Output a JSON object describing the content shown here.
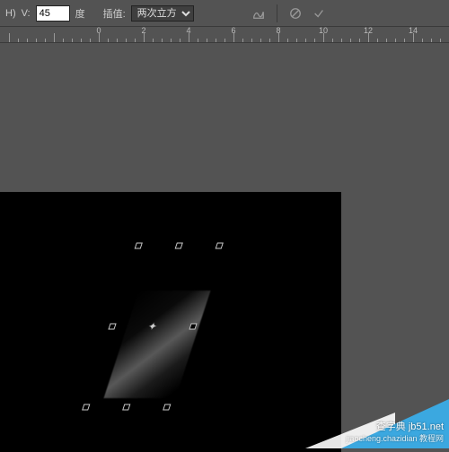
{
  "toolbar": {
    "v_label": "V:",
    "v_value": "45",
    "v_unit": "度",
    "interp_label": "插值:",
    "interp_value": "两次立方"
  },
  "ruler": {
    "majors": [
      {
        "pos": 10,
        "label": ""
      },
      {
        "pos": 60,
        "label": ""
      },
      {
        "pos": 110,
        "label": "0"
      },
      {
        "pos": 160,
        "label": "2"
      },
      {
        "pos": 210,
        "label": "4"
      },
      {
        "pos": 260,
        "label": "6"
      },
      {
        "pos": 310,
        "label": "8"
      },
      {
        "pos": 360,
        "label": "10"
      },
      {
        "pos": 410,
        "label": "12"
      },
      {
        "pos": 460,
        "label": "14"
      }
    ]
  },
  "watermark": {
    "line1": "查字典 jb51.net",
    "line2": "jiaocheng.chazidian 教程网"
  }
}
